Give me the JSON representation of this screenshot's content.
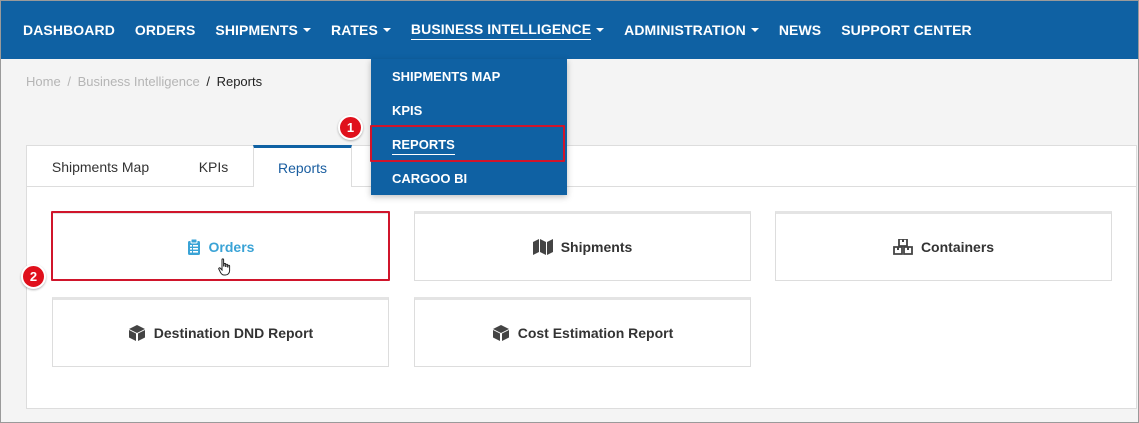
{
  "navbar": {
    "items": [
      {
        "label": "DASHBOARD",
        "caret": false
      },
      {
        "label": "ORDERS",
        "caret": false
      },
      {
        "label": "SHIPMENTS",
        "caret": true
      },
      {
        "label": "RATES",
        "caret": true
      },
      {
        "label": "BUSINESS INTELLIGENCE",
        "caret": true
      },
      {
        "label": "ADMINISTRATION",
        "caret": true
      },
      {
        "label": "NEWS",
        "caret": false
      },
      {
        "label": "SUPPORT CENTER",
        "caret": false
      }
    ],
    "active": "BUSINESS INTELLIGENCE",
    "color": "#0f61a3"
  },
  "dropdown": {
    "items": [
      {
        "label": "SHIPMENTS MAP"
      },
      {
        "label": "KPIS"
      },
      {
        "label": "REPORTS"
      },
      {
        "label": "CARGOO BI"
      }
    ],
    "active": "REPORTS"
  },
  "breadcrumb": {
    "home": "Home",
    "section": "Business Intelligence",
    "current": "Reports",
    "separator": "/"
  },
  "tabs": [
    {
      "label": "Shipments Map"
    },
    {
      "label": "KPIs"
    },
    {
      "label": "Reports"
    }
  ],
  "active_tab": "Reports",
  "reports": [
    {
      "label": "Orders",
      "icon": "clipboard-icon"
    },
    {
      "label": "Shipments",
      "icon": "map-icon"
    },
    {
      "label": "Containers",
      "icon": "boxes-icon"
    },
    {
      "label": "Destination DND Report",
      "icon": "box-icon"
    },
    {
      "label": "Cost Estimation Report",
      "icon": "box-icon"
    }
  ],
  "markers": [
    "1",
    "2"
  ],
  "colors": {
    "highlight": "#d0152b",
    "marker": "#e0101c",
    "link": "#3aa3d6"
  }
}
